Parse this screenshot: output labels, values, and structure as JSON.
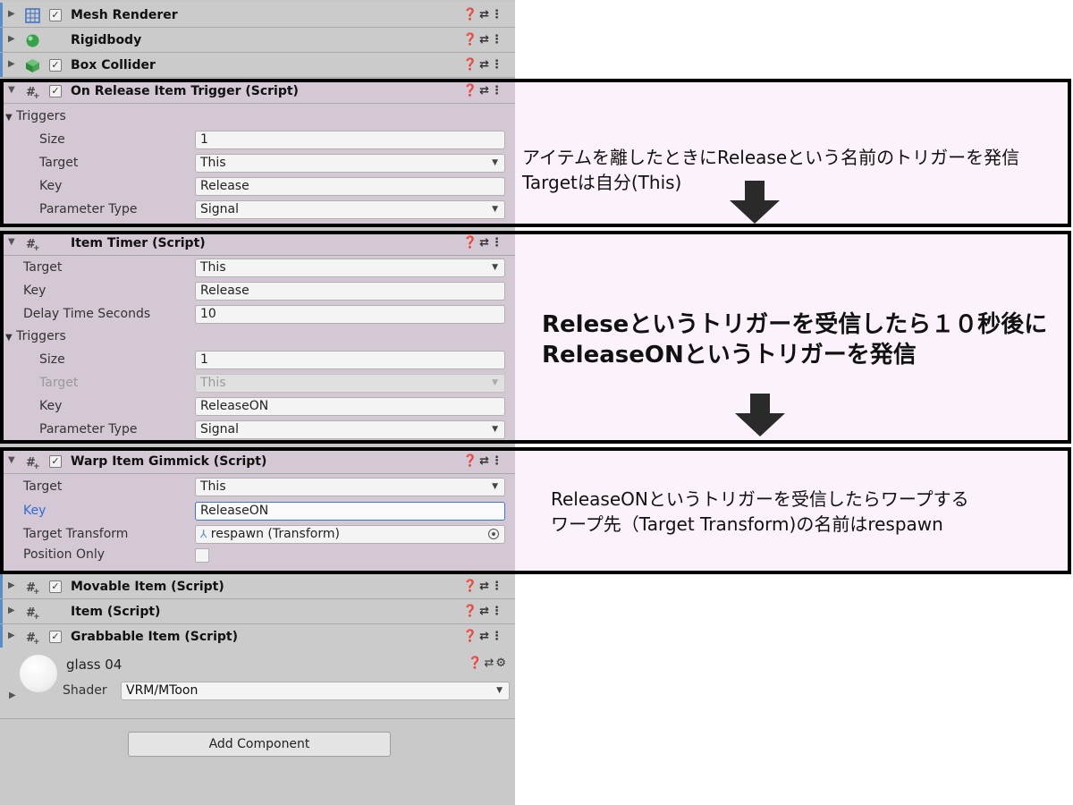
{
  "components_top": [
    {
      "title": "Mesh Renderer",
      "has_checkbox": true,
      "icon": "mesh-renderer-icon"
    },
    {
      "title": "Rigidbody",
      "has_checkbox": false,
      "icon": "rigidbody-icon"
    },
    {
      "title": "Box Collider",
      "has_checkbox": true,
      "icon": "box-collider-icon"
    }
  ],
  "on_release": {
    "title": "On Release Item Trigger (Script)",
    "triggers_label": "Triggers",
    "size_label": "Size",
    "size_value": "1",
    "target_label": "Target",
    "target_value": "This",
    "key_label": "Key",
    "key_value": "Release",
    "param_label": "Parameter Type",
    "param_value": "Signal"
  },
  "item_timer": {
    "title": "Item Timer (Script)",
    "target_label": "Target",
    "target_value": "This",
    "key_label": "Key",
    "key_value": "Release",
    "delay_label": "Delay Time Seconds",
    "delay_value": "10",
    "triggers_label": "Triggers",
    "size_label": "Size",
    "size_value": "1",
    "t_target_label": "Target",
    "t_target_value": "This",
    "t_key_label": "Key",
    "t_key_value": "ReleaseON",
    "param_label": "Parameter Type",
    "param_value": "Signal"
  },
  "warp": {
    "title": "Warp Item Gimmick (Script)",
    "target_label": "Target",
    "target_value": "This",
    "key_label": "Key",
    "key_value": "ReleaseON",
    "transform_label": "Target Transform",
    "transform_value": "respawn (Transform)",
    "position_only_label": "Position Only"
  },
  "components_bottom": [
    {
      "title": "Movable Item (Script)",
      "has_checkbox": true
    },
    {
      "title": "Item (Script)",
      "has_checkbox": false
    },
    {
      "title": "Grabbable Item (Script)",
      "has_checkbox": true
    }
  ],
  "material": {
    "name": "glass 04",
    "shader_label": "Shader",
    "shader_value": "VRM/MToon"
  },
  "add_component_label": "Add Component",
  "notes": {
    "note1_line1": "アイテムを離したときにReleaseという名前のトリガーを発信",
    "note1_line2": "Targetは自分(This)",
    "note2_line1": "Releseというトリガーを受信したら１０秒後に",
    "note2_line2": "ReleaseONというトリガーを発信",
    "note3_line1": "ReleaseONというトリガーを受信したらワープする",
    "note3_line2": "ワープ先（Target Transform)の名前はrespawn"
  },
  "colors": {
    "highlight": "#dec8de",
    "note_bg": "#fbf2fb",
    "accent_blue": "#2f6bd6",
    "panel": "#c8c8c8"
  }
}
